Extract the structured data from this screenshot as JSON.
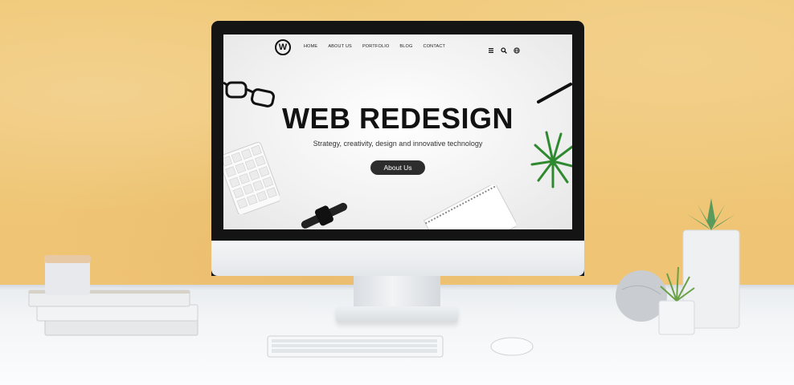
{
  "site": {
    "logo_letter": "W",
    "nav": [
      "HOME",
      "ABOUT US",
      "PORTFOLIO",
      "BLOG",
      "CONTACT"
    ],
    "icons": [
      "menu-icon",
      "search-icon",
      "globe-icon"
    ],
    "hero": {
      "title": "WEB REDESIGN",
      "subtitle": "Strategy, creativity, design and innovative technology",
      "button_label": "About Us"
    }
  },
  "colors": {
    "wall": "#efc877",
    "desk": "#f0f2f4",
    "bezel": "#141414",
    "button": "#2d2d2d"
  }
}
